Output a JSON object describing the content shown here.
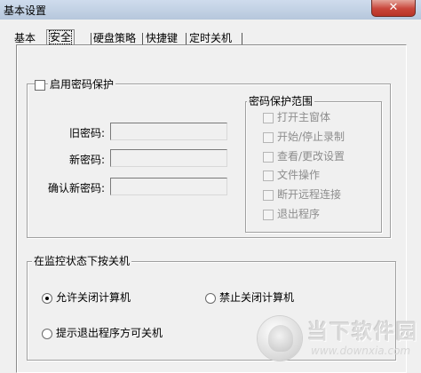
{
  "window": {
    "title": "基本设置",
    "close_symbol": "✕"
  },
  "tabs": [
    {
      "label": "基本",
      "active": false
    },
    {
      "label": "安全",
      "active": true
    },
    {
      "label": "硬盘策略",
      "active": false
    },
    {
      "label": "快捷键",
      "active": false
    },
    {
      "label": "定时关机",
      "active": false
    }
  ],
  "password": {
    "enable_label": "启用密码保护",
    "enabled": false,
    "old_password_label": "旧密码:",
    "new_password_label": "新密码:",
    "confirm_password_label": "确认新密码:",
    "old_password_value": "",
    "new_password_value": "",
    "confirm_password_value": "",
    "scope": {
      "title": "密码保护范围",
      "items": [
        {
          "label": "打开主窗体",
          "checked": false
        },
        {
          "label": "开始/停止录制",
          "checked": false
        },
        {
          "label": "查看/更改设置",
          "checked": false
        },
        {
          "label": "文件操作",
          "checked": false
        },
        {
          "label": "断开远程连接",
          "checked": false
        },
        {
          "label": "退出程序",
          "checked": false
        }
      ]
    }
  },
  "shutdown": {
    "title": "在监控状态下按关机",
    "options": [
      {
        "label": "允许关闭计算机",
        "selected": true
      },
      {
        "label": "禁止关闭计算机",
        "selected": false
      },
      {
        "label": "提示退出程序方可关机",
        "selected": false
      }
    ]
  },
  "watermark": {
    "name": "当下软件园",
    "url": "www.downxia.com"
  }
}
